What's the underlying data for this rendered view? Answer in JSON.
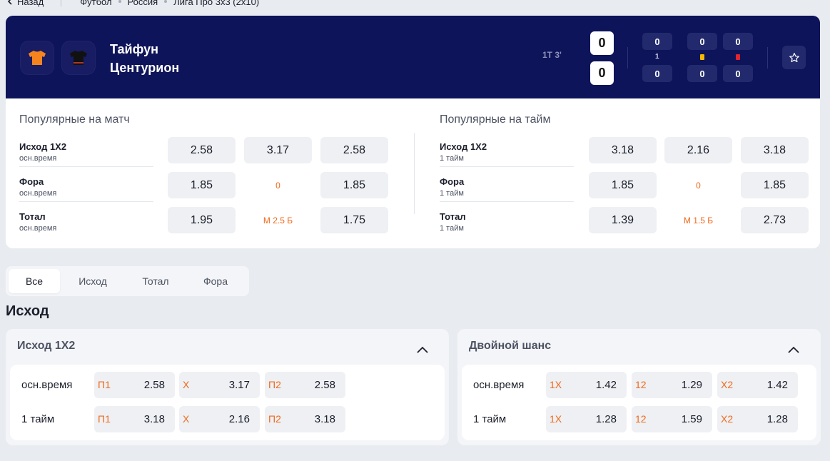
{
  "breadcrumb": {
    "back": "Назад",
    "items": [
      "Футбол",
      "Россия",
      "Лига Про 3x3 (2x10)"
    ]
  },
  "match": {
    "team1": "Тайфун",
    "team2": "Центурион",
    "period": "1Т 3'",
    "score1": "0",
    "score2": "0",
    "stats": {
      "c1_top": "0",
      "c1_mid": "1",
      "c1_bot": "0",
      "c2_top": "0",
      "c2_bot": "0",
      "c3_top": "0",
      "c3_bot": "0"
    }
  },
  "popular": {
    "match": {
      "title": "Популярные на матч",
      "rows": [
        {
          "label": "Исход 1X2",
          "sub": "осн.время",
          "o1": "2.58",
          "o2": "3.17",
          "o3": "2.58"
        },
        {
          "label": "Фора",
          "sub": "осн.время",
          "o1": "1.85",
          "o2": "0",
          "o3": "1.85"
        },
        {
          "label": "Тотал",
          "sub": "осн.время",
          "o1": "1.95",
          "o2": "М 2.5 Б",
          "o3": "1.75"
        }
      ]
    },
    "half": {
      "title": "Популярные на тайм",
      "rows": [
        {
          "label": "Исход 1X2",
          "sub": "1 тайм",
          "o1": "3.18",
          "o2": "2.16",
          "o3": "3.18"
        },
        {
          "label": "Фора",
          "sub": "1 тайм",
          "o1": "1.85",
          "o2": "0",
          "o3": "1.85"
        },
        {
          "label": "Тотал",
          "sub": "1 тайм",
          "o1": "1.39",
          "o2": "М 1.5 Б",
          "o3": "2.73"
        }
      ]
    }
  },
  "tabs": [
    "Все",
    "Исход",
    "Тотал",
    "Фора"
  ],
  "section_title": "Исход",
  "markets": [
    {
      "title": "Исход 1X2",
      "rows": [
        {
          "label": "осн.время",
          "cells": [
            {
              "k": "П1",
              "v": "2.58"
            },
            {
              "k": "Х",
              "v": "3.17"
            },
            {
              "k": "П2",
              "v": "2.58"
            }
          ]
        },
        {
          "label": "1 тайм",
          "cells": [
            {
              "k": "П1",
              "v": "3.18"
            },
            {
              "k": "Х",
              "v": "2.16"
            },
            {
              "k": "П2",
              "v": "3.18"
            }
          ]
        }
      ]
    },
    {
      "title": "Двойной шанс",
      "rows": [
        {
          "label": "осн.время",
          "cells": [
            {
              "k": "1Х",
              "v": "1.42"
            },
            {
              "k": "12",
              "v": "1.29"
            },
            {
              "k": "Х2",
              "v": "1.42"
            }
          ]
        },
        {
          "label": "1 тайм",
          "cells": [
            {
              "k": "1Х",
              "v": "1.28"
            },
            {
              "k": "12",
              "v": "1.59"
            },
            {
              "k": "Х2",
              "v": "1.28"
            }
          ]
        }
      ]
    }
  ],
  "colors": {
    "header_bg": "#0e1459",
    "accent_orange": "#f06a1d",
    "team1_jersey": "#f5841f",
    "team2_jersey": "#111111"
  }
}
